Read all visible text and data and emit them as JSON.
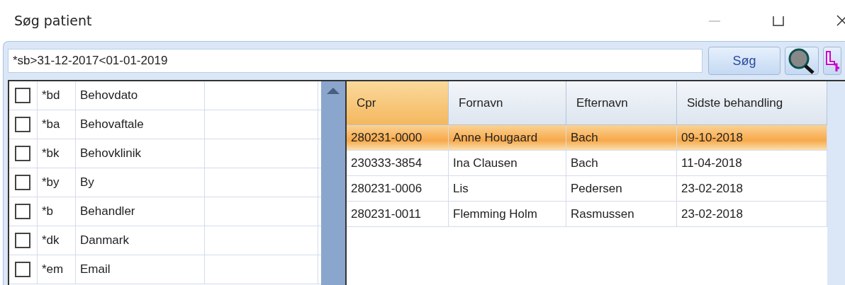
{
  "window": {
    "title": "Søg patient"
  },
  "search": {
    "value": "*sb>31-12-2017<01-01-2019",
    "button": "Søg"
  },
  "fields": [
    {
      "code": "*bd",
      "name": "Behovdato",
      "checked": false
    },
    {
      "code": "*ba",
      "name": "Behovaftale",
      "checked": false
    },
    {
      "code": "*bk",
      "name": "Behovklinik",
      "checked": false
    },
    {
      "code": "*by",
      "name": "By",
      "checked": false
    },
    {
      "code": "*b",
      "name": "Behandler",
      "checked": false
    },
    {
      "code": "*dk",
      "name": "Danmark",
      "checked": false
    },
    {
      "code": "*em",
      "name": "Email",
      "checked": false
    }
  ],
  "table": {
    "columns": [
      {
        "label": "Cpr",
        "selected": true
      },
      {
        "label": "Fornavn",
        "selected": false
      },
      {
        "label": "Efternavn",
        "selected": false
      },
      {
        "label": "Sidste behandling",
        "selected": false
      }
    ],
    "rows": [
      {
        "cells": [
          "280231-0000",
          "Anne Hougaard",
          "Bach",
          "09-10-2018"
        ],
        "selected": true
      },
      {
        "cells": [
          "230333-3854",
          "Ina Clausen",
          "Bach",
          "11-04-2018"
        ],
        "selected": false
      },
      {
        "cells": [
          "280231-0006",
          "Lis",
          "Pedersen",
          "23-02-2018"
        ],
        "selected": false
      },
      {
        "cells": [
          "280231-0011",
          "Flemming Holm",
          "Rasmussen",
          "23-02-2018"
        ],
        "selected": false
      }
    ]
  }
}
